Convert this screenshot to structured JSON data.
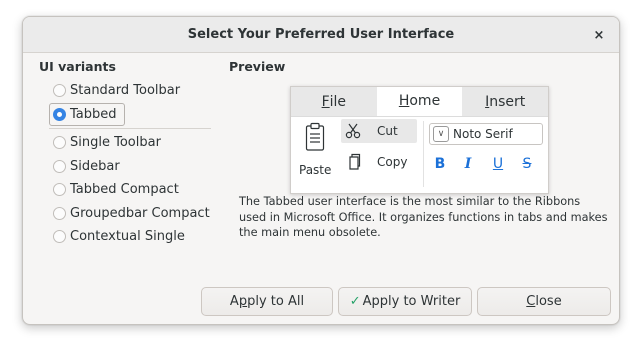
{
  "dialog": {
    "title": "Select Your Preferred User Interface",
    "close_glyph": "×"
  },
  "variants": {
    "heading": "UI variants",
    "items": [
      {
        "label": "Standard Toolbar",
        "checked": false
      },
      {
        "label": "Tabbed",
        "checked": true
      },
      {
        "label": "Single Toolbar",
        "checked": false
      },
      {
        "label": "Sidebar",
        "checked": false
      },
      {
        "label": "Tabbed Compact",
        "checked": false
      },
      {
        "label": "Groupedbar Compact",
        "checked": false
      },
      {
        "label": "Contextual Single",
        "checked": false
      }
    ]
  },
  "preview": {
    "heading": "Preview",
    "tabs": [
      {
        "label": "File",
        "mnemonic": "F",
        "rest": "ile",
        "active": false
      },
      {
        "label": "Home",
        "mnemonic": "H",
        "rest": "ome",
        "active": true
      },
      {
        "label": "Insert",
        "mnemonic": "I",
        "rest": "nsert",
        "active": false
      }
    ],
    "paste_label": "Paste",
    "cut_label": "Cut",
    "copy_label": "Copy",
    "font_name": "Noto Serif",
    "format_buttons": {
      "bold": "B",
      "italic": "I",
      "underline": "U",
      "strike": "S"
    }
  },
  "description": "The Tabbed user interface is the most similar to the Ribbons used in Microsoft Office. It organizes functions in tabs and makes the main menu obsolete.",
  "buttons": {
    "apply_all": {
      "pre": "A",
      "mnemonic": "p",
      "post": "ply to All"
    },
    "apply_writer": {
      "check": "✓",
      "label": "Apply to Writer"
    },
    "close": {
      "mnemonic": "C",
      "post": "lose"
    }
  },
  "colors": {
    "accent": "#3584e4",
    "format_blue": "#1c71d8",
    "check_green": "#26a269"
  }
}
